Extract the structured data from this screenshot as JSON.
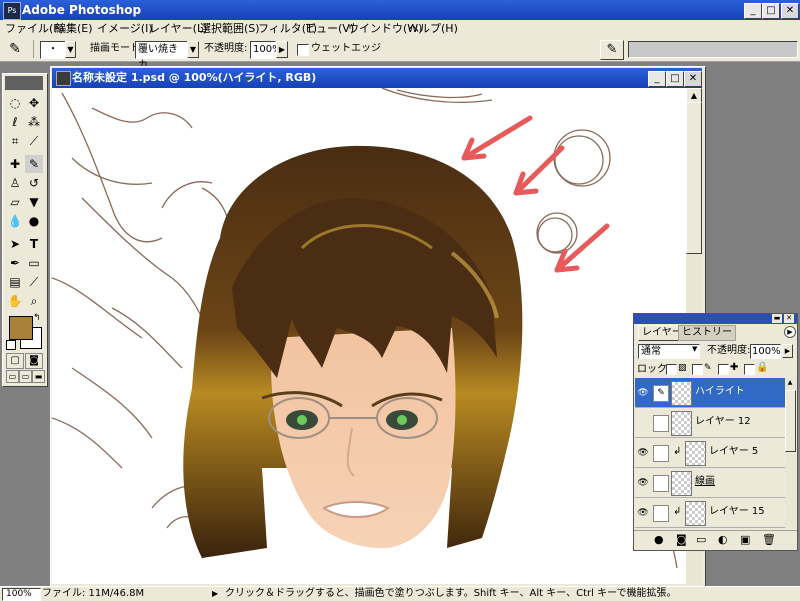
{
  "app": {
    "title": "Adobe Photoshop",
    "window_buttons": {
      "minimize": "_",
      "maximize": "□",
      "close": "✕"
    }
  },
  "menu": [
    "ファイル(F)",
    "編集(E)",
    "イメージ(I)",
    "レイヤー(L)",
    "選択範囲(S)",
    "フィルタ(T)",
    "ビュー(V)",
    "ウインドウ(W)",
    "ヘルプ(H)"
  ],
  "options": {
    "brush_size": "・",
    "mode_label": "描画モード :",
    "mode_value": "覆い焼きカ...",
    "opacity_label": "不透明度:",
    "opacity_value": "100%",
    "wet_edges_label": "ウェットエッジ"
  },
  "document": {
    "title": "名称未設定 1.psd @ 100%(ハイライト, RGB)"
  },
  "layers_panel": {
    "tabs": [
      "レイヤー",
      "ヒストリー"
    ],
    "blend_mode": "通常",
    "opacity_label": "不透明度:",
    "opacity_value": "100%",
    "lock_label": "ロック:",
    "layers": [
      {
        "name": "ハイライト",
        "visible": true,
        "active": true,
        "clipped": false
      },
      {
        "name": "レイヤー 12",
        "visible": false,
        "active": false,
        "clipped": false
      },
      {
        "name": "レイヤー 5",
        "visible": true,
        "active": false,
        "clipped": true
      },
      {
        "name": "線画",
        "visible": true,
        "active": false,
        "clipped": false
      },
      {
        "name": "レイヤー 15",
        "visible": true,
        "active": false,
        "clipped": true
      }
    ]
  },
  "status": {
    "zoom": "100%",
    "file_info": "ファイル: 11M/46.8M",
    "hint": "クリック＆ドラッグすると、描画色で塗りつぶします。Shift キー、Alt キー、Ctrl キーで機能拡張。"
  },
  "colors": {
    "foreground": "#a8803a",
    "background": "#ffffff",
    "titlebar": "#2452c8",
    "selection": "#3169c6"
  }
}
